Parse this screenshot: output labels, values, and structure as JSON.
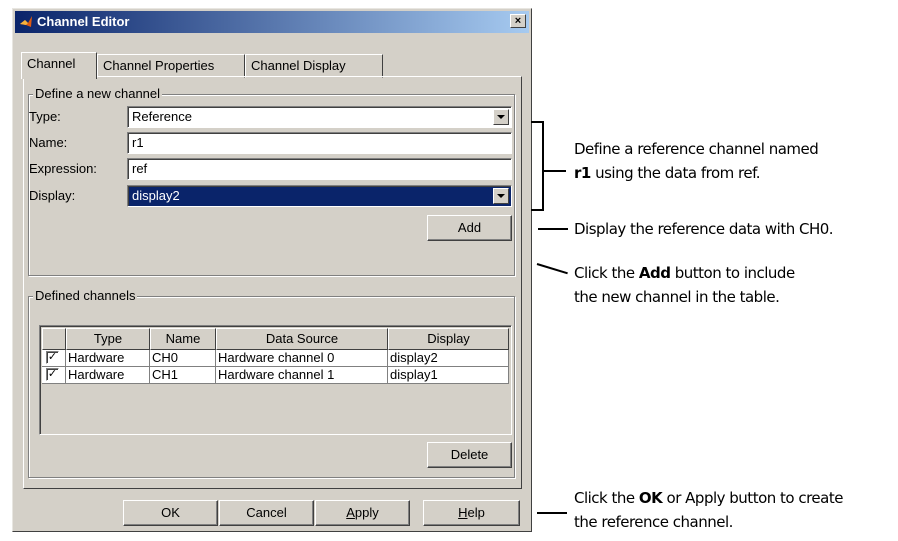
{
  "window": {
    "title": "Channel Editor",
    "close_glyph": "×"
  },
  "tabs": [
    {
      "label": "Channel"
    },
    {
      "label": "Channel Properties"
    },
    {
      "label": "Channel Display"
    }
  ],
  "define_group": {
    "legend": "Define a new channel",
    "type_label": "Type:",
    "type_value": "Reference",
    "name_label": "Name:",
    "name_value": "r1",
    "expression_label": "Expression:",
    "expression_value": "ref",
    "display_label": "Display:",
    "display_value": "display2",
    "add_button": "Add"
  },
  "defined_group": {
    "legend": "Defined channels",
    "columns": [
      "Type",
      "Name",
      "Data Source",
      "Display"
    ],
    "rows": [
      {
        "checked": "✓",
        "type": "Hardware",
        "name": "CH0",
        "source": "Hardware channel 0",
        "display": "display2"
      },
      {
        "checked": "✓",
        "type": "Hardware",
        "name": "CH1",
        "source": "Hardware channel 1",
        "display": "display1"
      }
    ],
    "delete_button": "Delete"
  },
  "footer": {
    "ok": "OK",
    "cancel": "Cancel",
    "apply_u": "A",
    "apply_rest": "pply",
    "help_u": "H",
    "help_rest": "elp"
  },
  "callouts": {
    "c1_line1": "Define a reference channel named",
    "c1_line2_bold": "r1",
    "c1_line2_rest": " using the data from ref.",
    "c2": "Display the reference data with CH0.",
    "c3_pre": "Click the ",
    "c3_bold": "Add",
    "c3_post": " button to include",
    "c3_line2": "the new channel in the table.",
    "c4_pre": "Click the ",
    "c4_bold": "OK",
    "c4_post": " or Apply button to create",
    "c4_line2": "the reference channel."
  },
  "colors": {
    "titlebar": "#0a246a",
    "selection": "#0a246a",
    "face": "#d4d0c8"
  }
}
